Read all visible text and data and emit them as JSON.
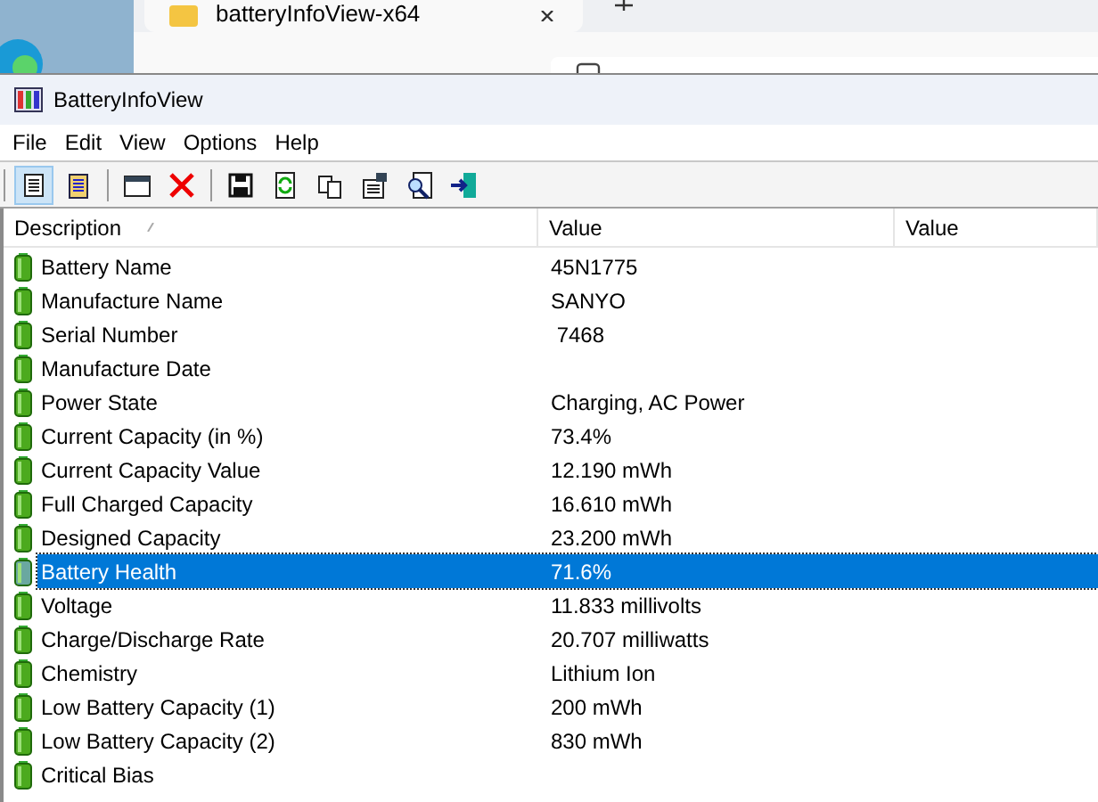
{
  "explorer": {
    "tab_title": "batteryInfoView-x64"
  },
  "window": {
    "title": "BatteryInfoView"
  },
  "menu": [
    "File",
    "Edit",
    "View",
    "Options",
    "Help"
  ],
  "toolbar": [
    {
      "kind": "props",
      "selected": true
    },
    {
      "kind": "clipboard",
      "selected": false
    },
    {
      "kind": "sep"
    },
    {
      "kind": "window",
      "selected": false
    },
    {
      "kind": "delete",
      "selected": false
    },
    {
      "kind": "sep"
    },
    {
      "kind": "save",
      "selected": false
    },
    {
      "kind": "refresh",
      "selected": false
    },
    {
      "kind": "copy",
      "selected": false
    },
    {
      "kind": "options",
      "selected": false
    },
    {
      "kind": "find",
      "selected": false
    },
    {
      "kind": "exit",
      "selected": false
    }
  ],
  "table": {
    "columns": [
      "Description",
      "Value",
      "Value"
    ],
    "rows": [
      {
        "description": "Battery Name",
        "value": "45N1775",
        "selected": false
      },
      {
        "description": "Manufacture Name",
        "value": "SANYO",
        "selected": false
      },
      {
        "description": "Serial Number",
        "value": " 7468",
        "selected": false
      },
      {
        "description": "Manufacture Date",
        "value": "",
        "selected": false
      },
      {
        "description": "Power State",
        "value": "Charging, AC Power",
        "selected": false
      },
      {
        "description": "Current Capacity (in %)",
        "value": "73.4%",
        "selected": false
      },
      {
        "description": "Current Capacity Value",
        "value": "12.190 mWh",
        "selected": false
      },
      {
        "description": "Full Charged Capacity",
        "value": "16.610 mWh",
        "selected": false
      },
      {
        "description": "Designed Capacity",
        "value": "23.200 mWh",
        "selected": false
      },
      {
        "description": "Battery Health",
        "value": "71.6%",
        "selected": true
      },
      {
        "description": "Voltage",
        "value": "11.833 millivolts",
        "selected": false
      },
      {
        "description": "Charge/Discharge Rate",
        "value": "20.707 milliwatts",
        "selected": false
      },
      {
        "description": "Chemistry",
        "value": "Lithium Ion",
        "selected": false
      },
      {
        "description": "Low Battery Capacity (1)",
        "value": "200 mWh",
        "selected": false
      },
      {
        "description": "Low Battery Capacity (2)",
        "value": "830 mWh",
        "selected": false
      },
      {
        "description": "Critical Bias",
        "value": "",
        "selected": false
      }
    ]
  }
}
